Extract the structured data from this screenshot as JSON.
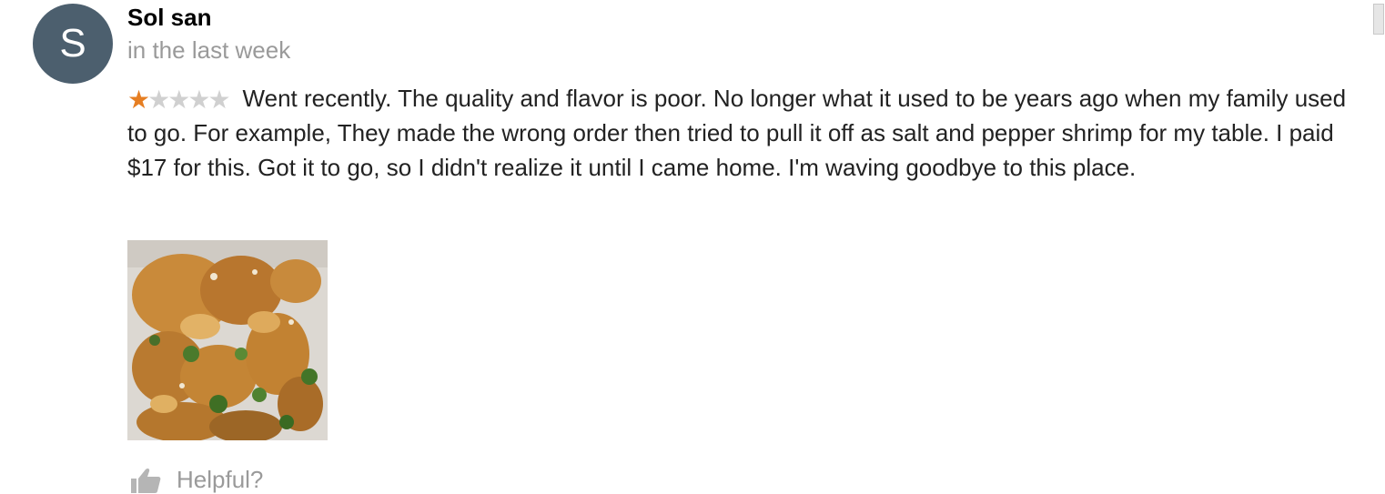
{
  "review": {
    "avatar_letter": "S",
    "author": "Sol san",
    "time": "in the last week",
    "rating": 1,
    "rating_max": 5,
    "text": "Went recently. The quality and flavor is poor. No longer what it used to be years ago when my family used to go. For example, They made the wrong order then tried to pull it off as salt and pepper shrimp for my table. I paid $17 for this. Got it to go, so I didn't realize it until I came home. I'm waving goodbye to this place.",
    "helpful_label": "Helpful?"
  },
  "colors": {
    "avatar_bg": "#4c5f6e",
    "star_on": "#e67e22",
    "star_off": "#d0d0d0",
    "muted_text": "#9a9a9a"
  },
  "icons": [
    "star-icon",
    "thumbs-up-icon"
  ]
}
